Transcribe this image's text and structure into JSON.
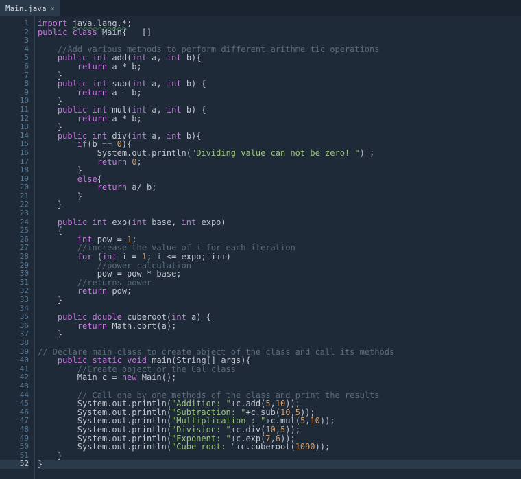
{
  "tab": {
    "filename": "Main.java",
    "close_glyph": "×"
  },
  "gutter": {
    "start": 1,
    "end": 52,
    "current": 52
  },
  "code_lines": [
    [
      [
        "kw",
        "import"
      ],
      [
        "id",
        " "
      ],
      [
        "underline",
        "java.lang.*"
      ],
      [
        "id",
        ";"
      ]
    ],
    [
      [
        "kw",
        "public"
      ],
      [
        "id",
        " "
      ],
      [
        "kw",
        "class"
      ],
      [
        "id",
        " Main{   []"
      ]
    ],
    [],
    [
      [
        "id",
        "    "
      ],
      [
        "com",
        "//Add various methods to perform different arithme tic operations"
      ]
    ],
    [
      [
        "id",
        "    "
      ],
      [
        "kw",
        "public"
      ],
      [
        "id",
        " "
      ],
      [
        "type",
        "int"
      ],
      [
        "id",
        " add("
      ],
      [
        "type",
        "int"
      ],
      [
        "id",
        " a, "
      ],
      [
        "type",
        "int"
      ],
      [
        "id",
        " b){"
      ]
    ],
    [
      [
        "id",
        "        "
      ],
      [
        "kw",
        "return"
      ],
      [
        "id",
        " a * b;"
      ]
    ],
    [
      [
        "id",
        "    }"
      ]
    ],
    [
      [
        "id",
        "    "
      ],
      [
        "kw",
        "public"
      ],
      [
        "id",
        " "
      ],
      [
        "type",
        "int"
      ],
      [
        "id",
        " sub("
      ],
      [
        "type",
        "int"
      ],
      [
        "id",
        " a, "
      ],
      [
        "type",
        "int"
      ],
      [
        "id",
        " b) {"
      ]
    ],
    [
      [
        "id",
        "        "
      ],
      [
        "kw",
        "return"
      ],
      [
        "id",
        " a - b;"
      ]
    ],
    [
      [
        "id",
        "    }"
      ]
    ],
    [
      [
        "id",
        "    "
      ],
      [
        "kw",
        "public"
      ],
      [
        "id",
        " "
      ],
      [
        "type",
        "int"
      ],
      [
        "id",
        " mul("
      ],
      [
        "type",
        "int"
      ],
      [
        "id",
        " a, "
      ],
      [
        "type",
        "int"
      ],
      [
        "id",
        " b) {"
      ]
    ],
    [
      [
        "id",
        "        "
      ],
      [
        "kw",
        "return"
      ],
      [
        "id",
        " a * b;"
      ]
    ],
    [
      [
        "id",
        "    }"
      ]
    ],
    [
      [
        "id",
        "    "
      ],
      [
        "kw",
        "public"
      ],
      [
        "id",
        " "
      ],
      [
        "type",
        "int"
      ],
      [
        "id",
        " div("
      ],
      [
        "type",
        "int"
      ],
      [
        "id",
        " a, "
      ],
      [
        "type",
        "int"
      ],
      [
        "id",
        " b){"
      ]
    ],
    [
      [
        "id",
        "        "
      ],
      [
        "kw",
        "if"
      ],
      [
        "id",
        "(b == "
      ],
      [
        "num",
        "0"
      ],
      [
        "id",
        "){"
      ]
    ],
    [
      [
        "id",
        "            System.out.println("
      ],
      [
        "str",
        "\"Dividing value can not be zero! \""
      ],
      [
        "id",
        ") ;"
      ]
    ],
    [
      [
        "id",
        "            "
      ],
      [
        "kw",
        "return"
      ],
      [
        "id",
        " "
      ],
      [
        "num",
        "0"
      ],
      [
        "id",
        ";"
      ]
    ],
    [
      [
        "id",
        "        }"
      ]
    ],
    [
      [
        "id",
        "        "
      ],
      [
        "kw",
        "else"
      ],
      [
        "id",
        "{"
      ]
    ],
    [
      [
        "id",
        "            "
      ],
      [
        "kw",
        "return"
      ],
      [
        "id",
        " a/ b;"
      ]
    ],
    [
      [
        "id",
        "        }"
      ]
    ],
    [
      [
        "id",
        "    }"
      ]
    ],
    [],
    [
      [
        "id",
        "    "
      ],
      [
        "kw",
        "public"
      ],
      [
        "id",
        " "
      ],
      [
        "type",
        "int"
      ],
      [
        "id",
        " exp("
      ],
      [
        "type",
        "int"
      ],
      [
        "id",
        " base, "
      ],
      [
        "type",
        "int"
      ],
      [
        "id",
        " expo)"
      ]
    ],
    [
      [
        "id",
        "    {"
      ]
    ],
    [
      [
        "id",
        "        "
      ],
      [
        "type",
        "int"
      ],
      [
        "id",
        " pow = "
      ],
      [
        "num",
        "1"
      ],
      [
        "id",
        ";"
      ]
    ],
    [
      [
        "id",
        "        "
      ],
      [
        "com",
        "//increase the value of i for each iteration"
      ]
    ],
    [
      [
        "id",
        "        "
      ],
      [
        "kw",
        "for"
      ],
      [
        "id",
        " ("
      ],
      [
        "type",
        "int"
      ],
      [
        "id",
        " i = "
      ],
      [
        "num",
        "1"
      ],
      [
        "id",
        "; i <= expo; i++)"
      ]
    ],
    [
      [
        "id",
        "            "
      ],
      [
        "com",
        "//power calculation"
      ]
    ],
    [
      [
        "id",
        "            pow = pow * base;"
      ]
    ],
    [
      [
        "id",
        "        "
      ],
      [
        "com",
        "//returns power"
      ]
    ],
    [
      [
        "id",
        "        "
      ],
      [
        "kw",
        "return"
      ],
      [
        "id",
        " pow;"
      ]
    ],
    [
      [
        "id",
        "    }"
      ]
    ],
    [],
    [
      [
        "id",
        "    "
      ],
      [
        "kw",
        "public"
      ],
      [
        "id",
        " "
      ],
      [
        "type",
        "double"
      ],
      [
        "id",
        " cuberoot("
      ],
      [
        "type",
        "int"
      ],
      [
        "id",
        " a) {"
      ]
    ],
    [
      [
        "id",
        "        "
      ],
      [
        "kw",
        "return"
      ],
      [
        "id",
        " Math.cbrt(a);"
      ]
    ],
    [
      [
        "id",
        "    }"
      ]
    ],
    [],
    [
      [
        "com",
        "// Declare main class to create object of the class and call its methods"
      ]
    ],
    [
      [
        "id",
        "    "
      ],
      [
        "kw",
        "public"
      ],
      [
        "id",
        " "
      ],
      [
        "kw",
        "static"
      ],
      [
        "id",
        " "
      ],
      [
        "type",
        "void"
      ],
      [
        "id",
        " main(String[] args){"
      ]
    ],
    [
      [
        "id",
        "        "
      ],
      [
        "com",
        "//Create object or the Cal class"
      ]
    ],
    [
      [
        "id",
        "        Main c = "
      ],
      [
        "kw",
        "new"
      ],
      [
        "id",
        " Main();"
      ]
    ],
    [],
    [
      [
        "id",
        "        "
      ],
      [
        "com",
        "// Call one by one methods of the class and print the results"
      ]
    ],
    [
      [
        "id",
        "        System.out.println("
      ],
      [
        "str",
        "\"Addition: \""
      ],
      [
        "id",
        "+c.add("
      ],
      [
        "num",
        "5"
      ],
      [
        "id",
        ","
      ],
      [
        "num",
        "10"
      ],
      [
        "id",
        "));"
      ]
    ],
    [
      [
        "id",
        "        System.out.println("
      ],
      [
        "str",
        "\"Subtraction: \""
      ],
      [
        "id",
        "+c.sub("
      ],
      [
        "num",
        "10"
      ],
      [
        "id",
        ","
      ],
      [
        "num",
        "5"
      ],
      [
        "id",
        "));"
      ]
    ],
    [
      [
        "id",
        "        System.out.println("
      ],
      [
        "str",
        "\"Multiplication : \""
      ],
      [
        "id",
        "+c.mul("
      ],
      [
        "num",
        "5"
      ],
      [
        "id",
        ","
      ],
      [
        "num",
        "10"
      ],
      [
        "id",
        "));"
      ]
    ],
    [
      [
        "id",
        "        System.out.println("
      ],
      [
        "str",
        "\"Division: \""
      ],
      [
        "id",
        "+c.div("
      ],
      [
        "num",
        "10"
      ],
      [
        "id",
        ","
      ],
      [
        "num",
        "5"
      ],
      [
        "id",
        "));"
      ]
    ],
    [
      [
        "id",
        "        System.out.println("
      ],
      [
        "str",
        "\"Exponent: \""
      ],
      [
        "id",
        "+c.exp("
      ],
      [
        "num",
        "7"
      ],
      [
        "id",
        ","
      ],
      [
        "num",
        "6"
      ],
      [
        "id",
        "));"
      ]
    ],
    [
      [
        "id",
        "        System.out.println("
      ],
      [
        "str",
        "\"Cube root: \""
      ],
      [
        "id",
        "+c.cuberoot("
      ],
      [
        "num",
        "1090"
      ],
      [
        "id",
        "));"
      ]
    ],
    [
      [
        "id",
        "    }"
      ]
    ],
    [
      [
        "id",
        "}"
      ]
    ]
  ]
}
